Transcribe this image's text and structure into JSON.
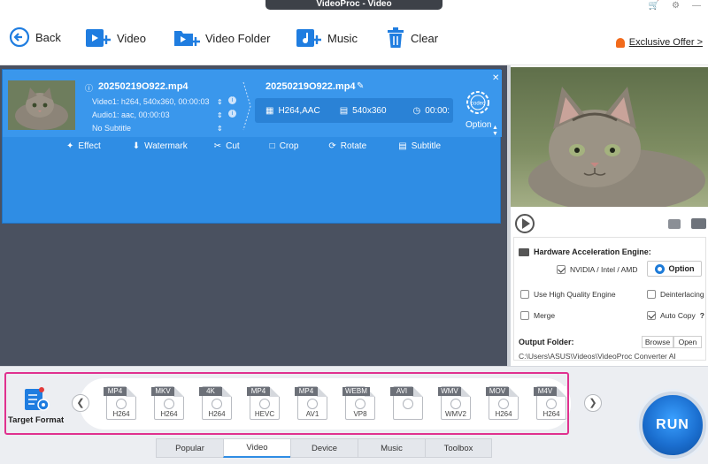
{
  "window": {
    "title": "VideoProc - Video"
  },
  "toolbar": {
    "back": "Back",
    "video": "Video",
    "video_folder": "Video Folder",
    "music": "Music",
    "clear": "Clear",
    "offer": "Exclusive Offer >"
  },
  "file": {
    "source_name": "20250219O922.mp4",
    "video_info": "Video1: h264, 540x360, 00:00:03",
    "audio_info": "Audio1: aac, 00:00:03",
    "subtitle_info": "No Subtitle",
    "output_name": "20250219O922.mp4",
    "out_codec": "H264,AAC",
    "out_resolution": "540x360",
    "out_duration": "00:00:",
    "codec_badge": "codec",
    "option_label": "Option"
  },
  "edit_tools": [
    "Effect",
    "Watermark",
    "Cut",
    "Crop",
    "Rotate",
    "Subtitle"
  ],
  "settings": {
    "hw_title": "Hardware Acceleration Engine:",
    "nvidia": "NVIDIA / Intel / AMD",
    "option_btn": "Option",
    "high_quality": "Use High Quality Engine",
    "deinterlacing": "Deinterlacing",
    "merge": "Merge",
    "auto_copy": "Auto Copy",
    "help": "?",
    "output_folder": "Output Folder:",
    "browse": "Browse",
    "open": "Open",
    "path": "C:\\Users\\ASUS\\Videos\\VideoProc Converter AI"
  },
  "target_format_label": "Target Format",
  "formats": [
    {
      "tag": "MP4",
      "codec": "H264"
    },
    {
      "tag": "MKV",
      "codec": "H264"
    },
    {
      "tag": "4K",
      "codec": "H264"
    },
    {
      "tag": "MP4",
      "codec": "HEVC"
    },
    {
      "tag": "MP4",
      "codec": "AV1"
    },
    {
      "tag": "WEBM",
      "codec": "VP8"
    },
    {
      "tag": "AVI",
      "codec": ""
    },
    {
      "tag": "WMV",
      "codec": "WMV2"
    },
    {
      "tag": "MOV",
      "codec": "H264"
    },
    {
      "tag": "M4V",
      "codec": "H264"
    }
  ],
  "tabs": [
    {
      "label": "Popular",
      "active": false
    },
    {
      "label": "Video",
      "active": true
    },
    {
      "label": "Device",
      "active": false
    },
    {
      "label": "Music",
      "active": false
    },
    {
      "label": "Toolbox",
      "active": false
    }
  ],
  "run_label": "RUN",
  "colors": {
    "accent": "#2f8de4",
    "highlight": "#e0318f",
    "panel_dark": "#4a5160"
  }
}
